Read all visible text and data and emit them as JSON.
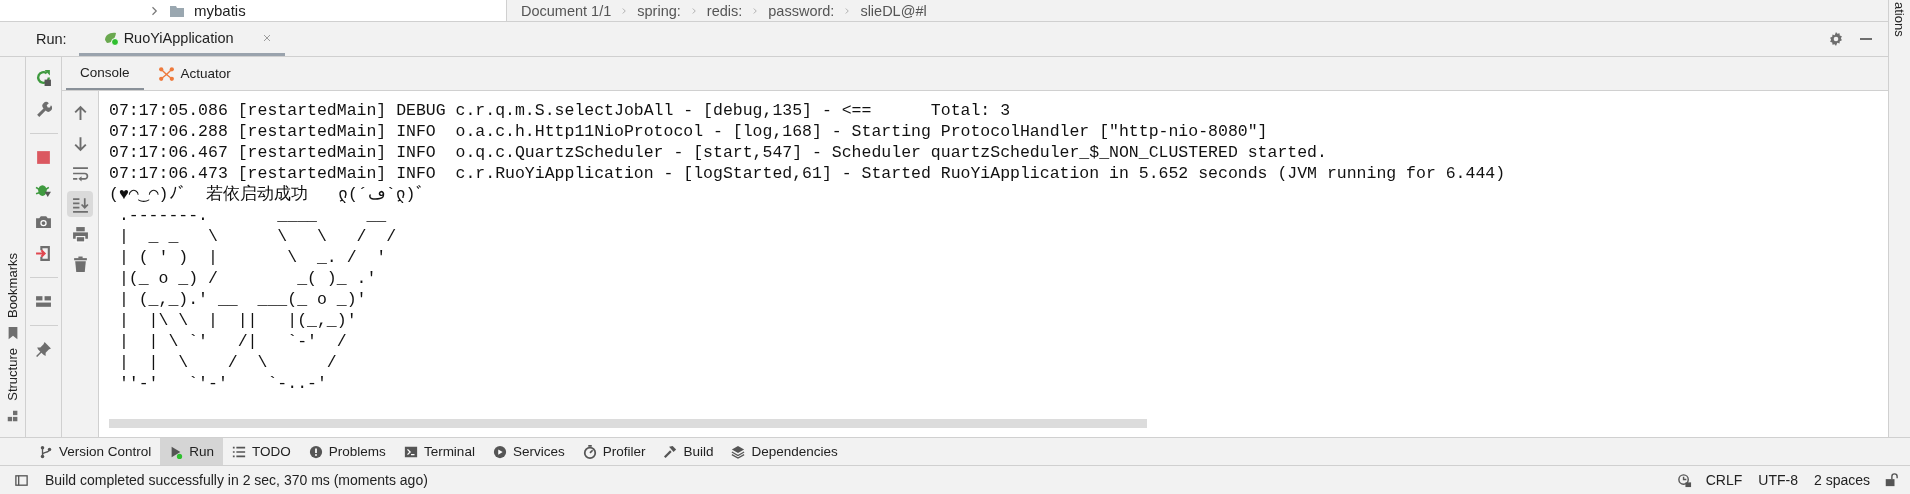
{
  "project_tree": {
    "items": [
      {
        "label": "mybatis",
        "expanded": false
      }
    ]
  },
  "breadcrumb": [
    "Document 1/1",
    "spring:",
    "redis:",
    "password:",
    "slieDL@#l"
  ],
  "right_strip": {
    "label": "ations"
  },
  "left_strip": [
    "Bookmarks",
    "Structure"
  ],
  "run_panel": {
    "label": "Run:",
    "tabs": [
      {
        "label": "RuoYiApplication",
        "selected": true
      }
    ]
  },
  "console_tabs": [
    {
      "label": "Console",
      "selected": true
    },
    {
      "label": "Actuator",
      "selected": false
    }
  ],
  "console": {
    "autoscroll": true,
    "lines": [
      "07:17:05.086 [restartedMain] DEBUG c.r.q.m.S.selectJobAll - [debug,135] - <==      Total: 3",
      "07:17:06.288 [restartedMain] INFO  o.a.c.h.Http11NioProtocol - [log,168] - Starting ProtocolHandler [\"http-nio-8080\"]",
      "07:17:06.467 [restartedMain] INFO  o.q.c.QuartzScheduler - [start,547] - Scheduler quartzScheduler_$_NON_CLUSTERED started.",
      "07:17:06.473 [restartedMain] INFO  c.r.RuoYiApplication - [logStarted,61] - Started RuoYiApplication in 5.652 seconds (JVM running for 6.444)",
      "(♥◠‿◠)ﾉﾞ  若依启动成功   ლ(´ڡ`ლ)ﾞ",
      " .-------.       ____     __",
      " |  _ _   \\      \\   \\   /  /",
      " | ( ' )  |       \\  _. /  '",
      " |(_ o _) /        _( )_ .'",
      " | (_,_).' __  ___(_ o _)'",
      " |  |\\ \\  |  ||   |(_,_)'",
      " |  | \\ `'   /|   `-'  /",
      " |  |  \\    /  \\      /",
      " ''-'   `'-'    `-..-'"
    ]
  },
  "tool_windows": [
    {
      "label": "Version Control",
      "selected": false
    },
    {
      "label": "Run",
      "selected": true
    },
    {
      "label": "TODO",
      "selected": false
    },
    {
      "label": "Problems",
      "selected": false
    },
    {
      "label": "Terminal",
      "selected": false
    },
    {
      "label": "Services",
      "selected": false
    },
    {
      "label": "Profiler",
      "selected": false
    },
    {
      "label": "Build",
      "selected": false
    },
    {
      "label": "Dependencies",
      "selected": false
    }
  ],
  "status_bar": {
    "message": "Build completed successfully in 2 sec, 370 ms (moments ago)",
    "line_separator": "CRLF",
    "encoding": "UTF-8",
    "indent": "2 spaces"
  }
}
